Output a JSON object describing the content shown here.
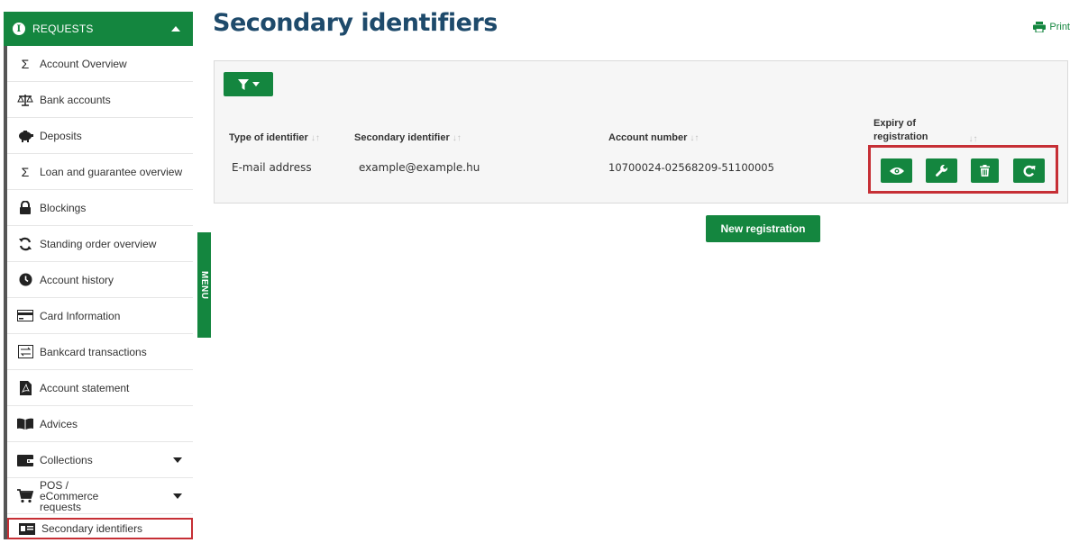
{
  "sidebar": {
    "header": "REQUESTS",
    "items": [
      {
        "label": "Account Overview",
        "icon": "sigma-icon"
      },
      {
        "label": "Bank accounts",
        "icon": "balance-scale-icon"
      },
      {
        "label": "Deposits",
        "icon": "piggy-bank-icon"
      },
      {
        "label": "Loan and guarantee overview",
        "icon": "sigma-icon"
      },
      {
        "label": "Blockings",
        "icon": "lock-icon"
      },
      {
        "label": "Standing order overview",
        "icon": "refresh-icon"
      },
      {
        "label": "Account history",
        "icon": "clock-icon"
      },
      {
        "label": "Card Information",
        "icon": "card-icon"
      },
      {
        "label": "Bankcard transactions",
        "icon": "exchange-icon"
      },
      {
        "label": "Account statement",
        "icon": "pdf-file-icon"
      },
      {
        "label": "Advices",
        "icon": "book-icon"
      },
      {
        "label": "Collections",
        "icon": "wallet-icon"
      },
      {
        "label": "POS / eCommerce requests",
        "icon": "cart-icon"
      },
      {
        "label": "Secondary identifiers",
        "icon": "id-card-icon"
      }
    ]
  },
  "menu_tab": "MENU",
  "page": {
    "title": "Secondary identifiers",
    "print_label": "Print"
  },
  "table": {
    "headers": {
      "type": "Type of identifier",
      "secondary": "Secondary identifier",
      "account": "Account number",
      "expiry_1": "Expiry of",
      "expiry_2": "registration"
    },
    "row": {
      "type": "E-mail address",
      "secondary": "example@example.hu",
      "account": "10700024-02568209-51100005"
    },
    "actions": [
      "view-icon",
      "wrench-icon",
      "trash-icon",
      "renew-icon"
    ]
  },
  "buttons": {
    "new_registration": "New registration"
  },
  "colors": {
    "accent": "#14863f",
    "title": "#1e4a6b",
    "highlight": "#c62f35"
  }
}
